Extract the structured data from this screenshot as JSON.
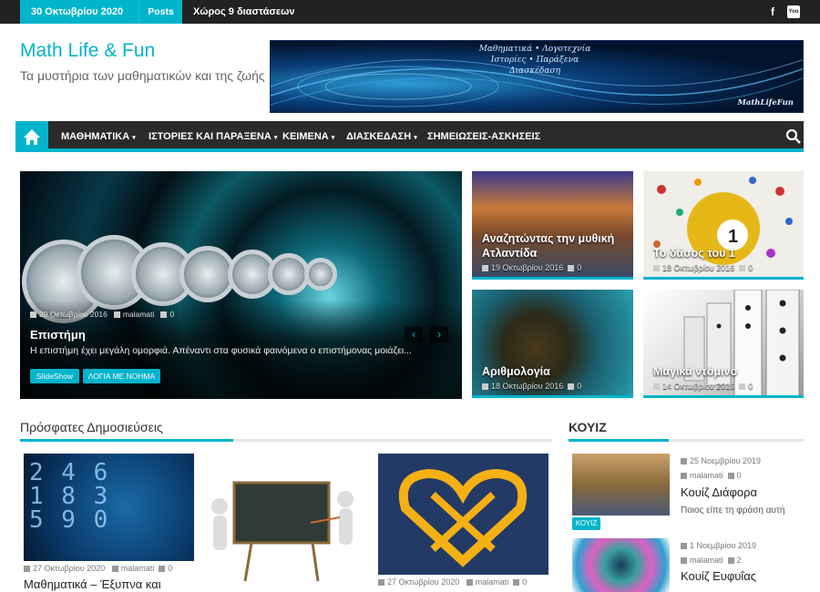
{
  "topbar": {
    "date": "30 Οκτωβρίου 2020",
    "posts_label": "Posts",
    "ticker": "Χώρος 9 διαστάσεων",
    "facebook_glyph": "f",
    "youtube_glyph": "You"
  },
  "header": {
    "title": "Math Life & Fun",
    "description": "Τα μυστήρια των μαθηματικών και της ζωής"
  },
  "banner": {
    "line1": "Μαθηματικά • Λογοτεχνία",
    "line2": "Ιστορίες • Παράξενα",
    "line3": "Διασκέδαση",
    "brand": "MathLifeFun"
  },
  "nav": {
    "items": [
      {
        "label": "ΜΑΘΗΜΑΤΙΚΑ",
        "dropdown": true
      },
      {
        "label": "ΙΣΤΟΡΙΕΣ ΚΑΙ ΠΑΡΑΞΕΝΑ",
        "dropdown": true
      },
      {
        "label": "ΚΕΙΜΕΝΑ",
        "dropdown": true
      },
      {
        "label": "ΔΙΑΣΚΕΔΑΣΗ",
        "dropdown": true
      },
      {
        "label": "ΣΗΜΕΙΩΣΕΙΣ-ΑΣΚΗΣΕΙΣ",
        "dropdown": false
      }
    ]
  },
  "hero": {
    "date": "20 Οκτωβρίου 2016",
    "author": "malamati",
    "comments": "0",
    "title": "Επιστήμη",
    "excerpt": "Η επιστήμη έχει μεγάλη ομορφιά. Απέναντι στα φυσικά φαινόμενα ο επιστήμονας μοιάζει...",
    "tags": [
      "SlideShow",
      "ΛΟΓΙΑ ΜΕ ΝΟΗΜΑ"
    ]
  },
  "tiles": [
    {
      "title": "Αναζητώντας την μυθική Ατλαντίδα",
      "date": "19 Οκτωβρίου 2016",
      "comments": "0"
    },
    {
      "title": "Το δάσος του 1",
      "date": "18 Οκτωβρίου 2016",
      "comments": "0"
    },
    {
      "title": "Αριθμολογία",
      "date": "18 Οκτωβρίου 2016",
      "comments": "0"
    },
    {
      "title": "Μαγικά ντόμινο",
      "date": "14 Οκτωβρίου 2016",
      "comments": "0"
    }
  ],
  "recent": {
    "heading": "Πρόσφατες Δημοσιεύσεις",
    "posts": [
      {
        "date": "27 Οκτωβρίου 2020",
        "author": "malamati",
        "comments": "0",
        "title": "Μαθηματικά – Έξυπνα και"
      },
      {
        "date": "",
        "author": "",
        "comments": "",
        "title": ""
      },
      {
        "date": "27 Οκτωβρίου 2020",
        "author": "malamati",
        "comments": "0",
        "title": ""
      }
    ]
  },
  "quiz": {
    "heading": "ΚΟΥΙΖ",
    "tag": "ΚΟΥΙΖ",
    "items": [
      {
        "date": "25 Νοεμβρίου 2019",
        "author": "malamati",
        "comments": "0",
        "title": "Κουίζ Διάφορα",
        "excerpt": "Ποιος είπε τη φράση αυτή"
      },
      {
        "date": "1 Νοεμβρίου 2019",
        "author": "malamati",
        "comments": "2",
        "title": "Κουίζ Ευφυΐας",
        "excerpt": ""
      }
    ]
  },
  "colors": {
    "accent": "#00b4cc",
    "dark": "#2b2b2b"
  }
}
